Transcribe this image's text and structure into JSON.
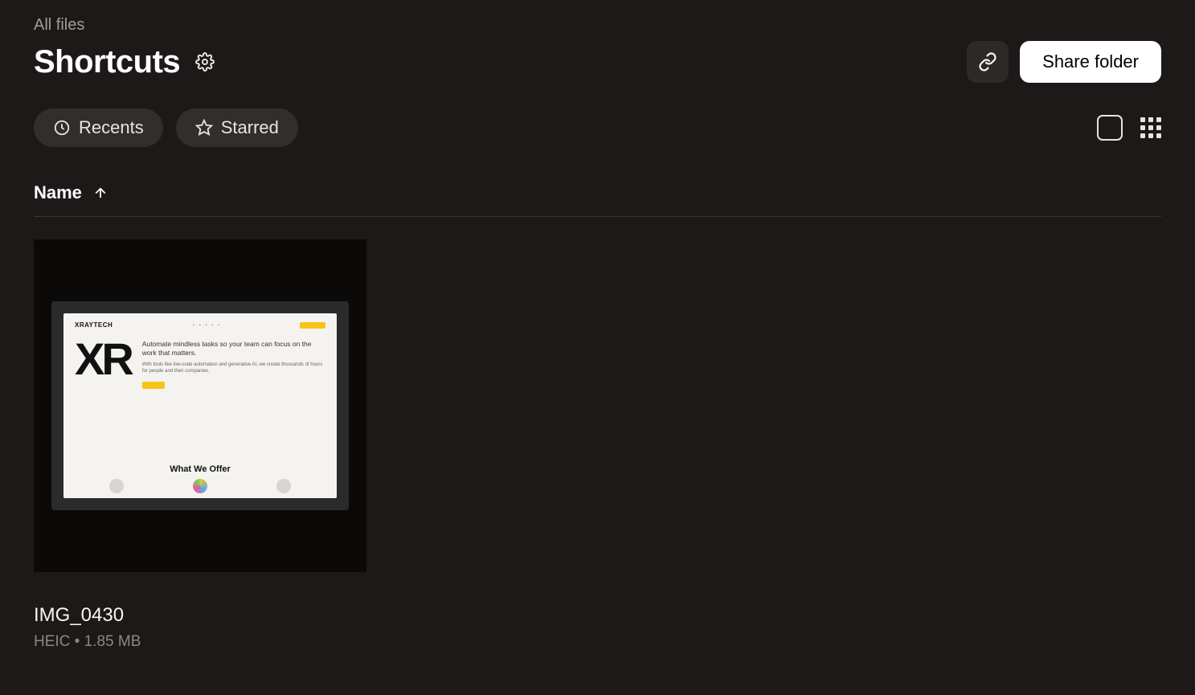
{
  "breadcrumb": {
    "root": "All files"
  },
  "folder": {
    "title": "Shortcuts"
  },
  "actions": {
    "share_label": "Share folder"
  },
  "filters": {
    "recents": "Recents",
    "starred": "Starred"
  },
  "table": {
    "col_name": "Name",
    "sort_direction": "asc"
  },
  "files": [
    {
      "name": "IMG_0430",
      "type": "HEIC",
      "size": "1.85 MB",
      "meta_display": "HEIC • 1.85 MB"
    }
  ],
  "thumbnail_content": {
    "brand": "XRAYTECH",
    "logo_text": "XR",
    "headline": "Automate mindless tasks so your team can focus on the work that matters.",
    "subtext": "With tools like low-code automation and generative AI, we create thousands of hours for people and their companies.",
    "section_title": "What We Offer"
  }
}
